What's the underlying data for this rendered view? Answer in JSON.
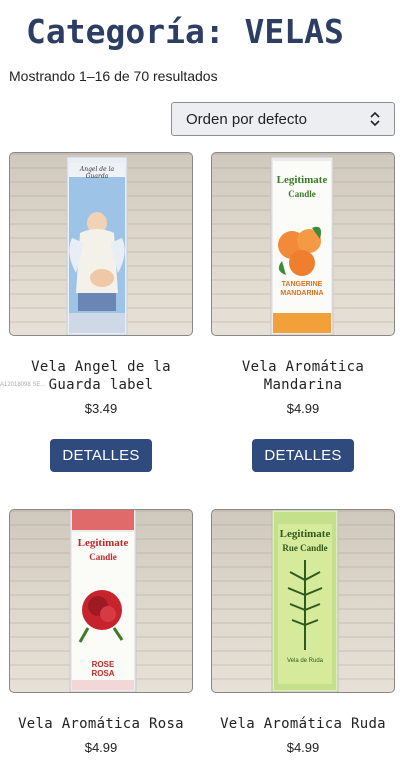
{
  "header": {
    "title": "Categoría: VELAS"
  },
  "results": {
    "count_text": "Mostrando 1–16 de 70 resultados"
  },
  "sort": {
    "selected": "Orden por defecto"
  },
  "watermark": "A12018098  SE...",
  "products": [
    {
      "name_line1": "Vela Angel de la",
      "name_line2": "Guarda label",
      "price": "$3.49",
      "button": "DETALLES",
      "label_top": "Angel de la Guarda"
    },
    {
      "name_line1": "Vela Aromática",
      "name_line2": "Mandarina",
      "price": "$4.99",
      "button": "DETALLES",
      "label_top": "Legitimate",
      "label_sub": "Candle",
      "label_bottom1": "TANGERINE",
      "label_bottom2": "MANDARINA"
    },
    {
      "name_line1": "Vela Aromática Rosa",
      "price": "$4.99",
      "label_top": "Legitimate",
      "label_sub": "Candle",
      "label_bottom1": "ROSE",
      "label_bottom2": "ROSA"
    },
    {
      "name_line1": "Vela Aromática Ruda",
      "price": "$4.99",
      "label_top": "Legitimate",
      "label_sub": "Rue Candle",
      "label_bottom1": "Vela de Ruda"
    }
  ],
  "colors": {
    "title": "#2c3e63",
    "button": "#2f4a7d"
  }
}
